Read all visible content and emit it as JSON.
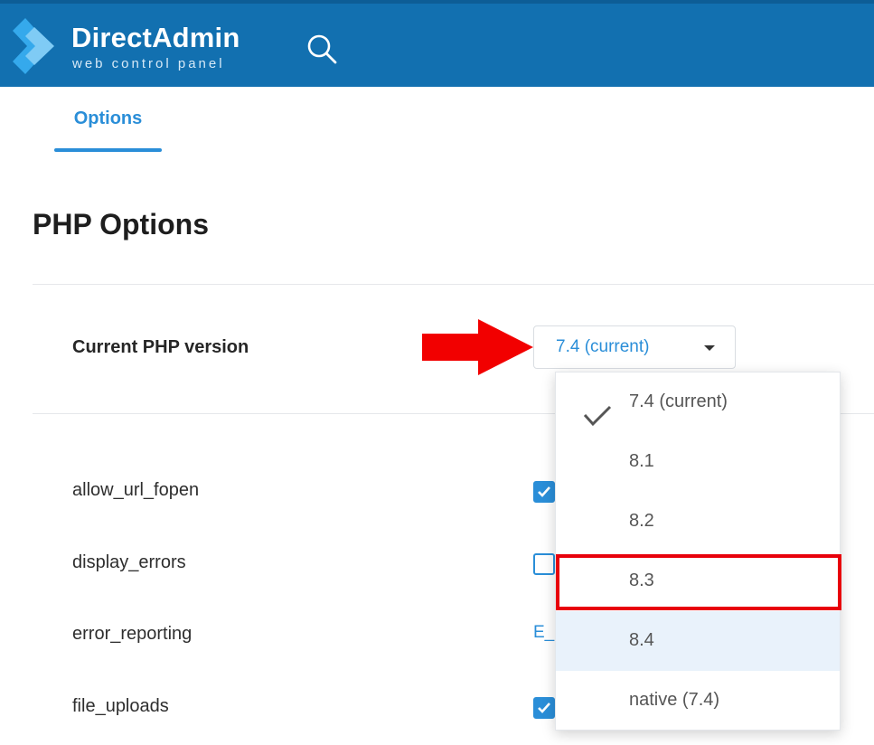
{
  "header": {
    "logo_title": "DirectAdmin",
    "logo_subtitle": "web control panel",
    "logo_icon": "directadmin-logo-icon",
    "search_icon": "search-icon",
    "background_color": "#1270b0"
  },
  "tabs": [
    {
      "label": "Options",
      "active": true
    }
  ],
  "page": {
    "title": "PHP Options"
  },
  "php_version": {
    "label": "Current PHP version",
    "selected_value": "7.4 (current)",
    "caret_icon": "caret-down-icon",
    "arrow_annotation_icon": "red-arrow-icon"
  },
  "settings": [
    {
      "name": "allow_url_fopen",
      "type": "checkbox",
      "checked": true
    },
    {
      "name": "display_errors",
      "type": "checkbox",
      "checked": false
    },
    {
      "name": "error_reporting",
      "type": "link",
      "value": "E_"
    },
    {
      "name": "file_uploads",
      "type": "checkbox",
      "checked": true
    }
  ],
  "dropdown": {
    "options": [
      {
        "label": "7.4 (current)",
        "selected": true
      },
      {
        "label": "8.1",
        "selected": false
      },
      {
        "label": "8.2",
        "selected": false
      },
      {
        "label": "8.3",
        "selected": false,
        "annotated": true
      },
      {
        "label": "8.4",
        "selected": false,
        "hovered": true
      },
      {
        "label": "native (7.4)",
        "selected": false
      }
    ],
    "highlight_color": "#e8000b"
  },
  "colors": {
    "accent": "#2a8ed8",
    "annotation_red": "#e8000b",
    "hover_bg": "#e9f2fb"
  }
}
